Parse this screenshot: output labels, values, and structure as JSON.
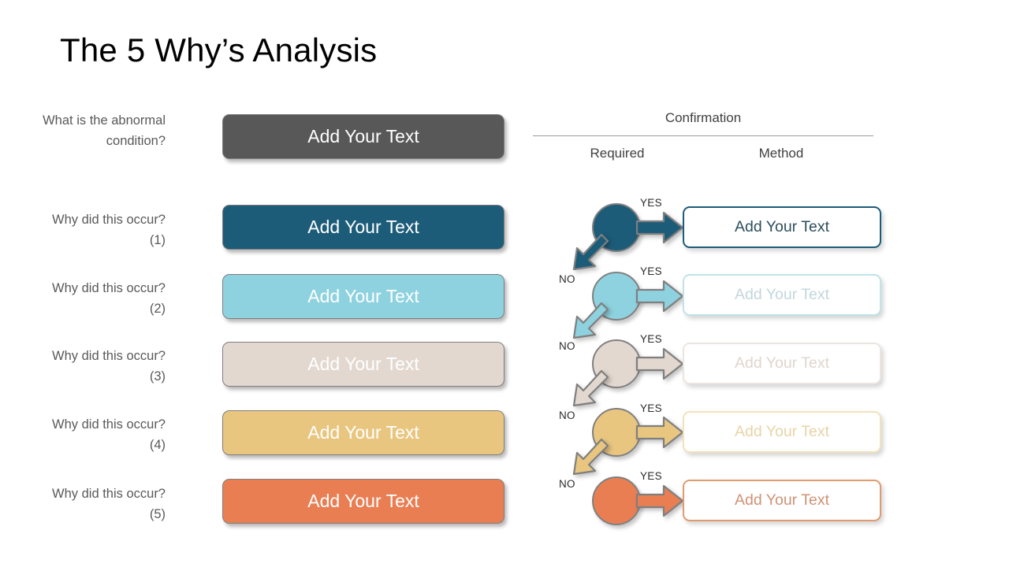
{
  "slide": {
    "title": "The 5 Why’s Analysis",
    "background": "#ffffff"
  },
  "confirmation": {
    "header": "Confirmation",
    "columns": {
      "required": "Required",
      "method": "Method"
    }
  },
  "branch_labels": {
    "yes": "YES",
    "no": "NO"
  },
  "rows": [
    {
      "question": "What is the abnormal condition?",
      "bar_text": "Add Your Text",
      "bar_color": "#585858",
      "bar_text_color": "#ffffff",
      "has_node": false,
      "node_color": "",
      "method_text": "",
      "method_border": "",
      "method_text_color": ""
    },
    {
      "question": "Why did this occur? (1)",
      "bar_text": "Add Your Text",
      "bar_color": "#1c5c78",
      "bar_text_color": "#ffffff",
      "has_node": true,
      "node_color": "#1c5c78",
      "arrow_color": "#1c5c78",
      "method_text": "Add Your Text",
      "method_border": "#1c5c78",
      "method_text_color": "#2c4f5e"
    },
    {
      "question": "Why did this occur? (2)",
      "bar_text": "Add Your Text",
      "bar_color": "#8ed2e0",
      "bar_text_color": "#ffffff",
      "has_node": true,
      "node_color": "#8ed2e0",
      "arrow_color": "#8ed2e0",
      "method_text": "Add Your Text",
      "method_border": "#bfe3e6",
      "method_text_color": "#c3d7dc"
    },
    {
      "question": "Why did this occur? (3)",
      "bar_text": "Add Your Text",
      "bar_color": "#e2d8d0",
      "bar_text_color": "#ffffff",
      "has_node": true,
      "node_color": "#e2d8d0",
      "arrow_color": "#e2d8d0",
      "method_text": "Add Your Text",
      "method_border": "#ece5df",
      "method_text_color": "#e0d6cd"
    },
    {
      "question": "Why did this occur? (4)",
      "bar_text": "Add Your Text",
      "bar_color": "#e9c680",
      "bar_text_color": "#ffffff",
      "has_node": true,
      "node_color": "#e9c680",
      "arrow_color": "#e9c680",
      "method_text": "Add Your Text",
      "method_border": "#f2e2bc",
      "method_text_color": "#e8d4a6"
    },
    {
      "question": "Why did this occur? (5)",
      "bar_text": "Add Your Text",
      "bar_color": "#e97e53",
      "bar_text_color": "#ffffff",
      "has_node": true,
      "node_color": "#e97e53",
      "arrow_color": "#e97e53",
      "method_text": "Add Your Text",
      "method_border": "#e09a70",
      "method_text_color": "#cf9275"
    }
  ]
}
